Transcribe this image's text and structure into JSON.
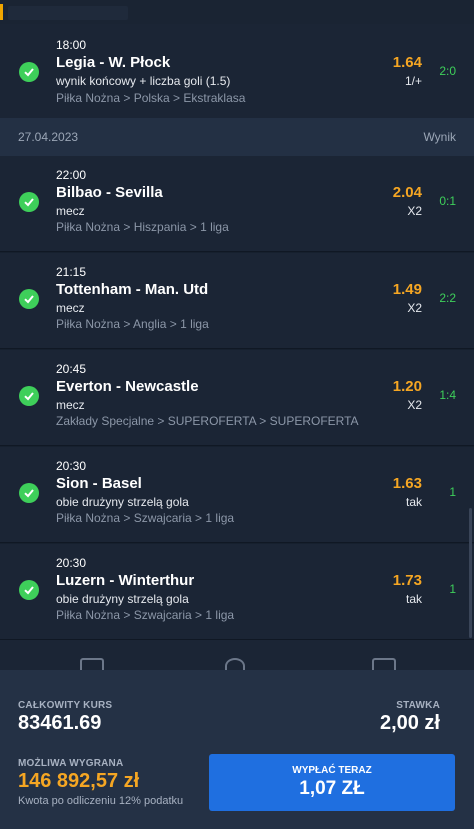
{
  "bets": [
    {
      "time": "18:00",
      "teams": "Legia - W. Płock",
      "market": "wynik końcowy + liczba goli (1.5)",
      "path": "Piłka Nożna > Polska > Ekstraklasa",
      "odds": "1.64",
      "pick": "1/+",
      "result": "2:0",
      "status_icon": "check-icon"
    },
    {
      "time": "22:00",
      "teams": "Bilbao - Sevilla",
      "market": "mecz",
      "path": "Piłka Nożna > Hiszpania > 1 liga",
      "odds": "2.04",
      "pick": "X2",
      "result": "0:1",
      "status_icon": "check-icon"
    },
    {
      "time": "21:15",
      "teams": "Tottenham - Man. Utd",
      "market": "mecz",
      "path": "Piłka Nożna > Anglia > 1 liga",
      "odds": "1.49",
      "pick": "X2",
      "result": "2:2",
      "status_icon": "check-icon"
    },
    {
      "time": "20:45",
      "teams": "Everton - Newcastle",
      "market": "mecz",
      "path": "Zakłady Specjalne > SUPEROFERTA > SUPEROFERTA",
      "odds": "1.20",
      "pick": "X2",
      "result": "1:4",
      "status_icon": "check-icon"
    },
    {
      "time": "20:30",
      "teams": "Sion - Basel",
      "market": "obie drużyny strzelą gola",
      "path": "Piłka Nożna > Szwajcaria > 1 liga",
      "odds": "1.63",
      "pick": "tak",
      "result": "1",
      "status_icon": "check-icon"
    },
    {
      "time": "20:30",
      "teams": "Luzern - Winterthur",
      "market": "obie drużyny strzelą gola",
      "path": "Piłka Nożna > Szwajcaria > 1 liga",
      "odds": "1.73",
      "pick": "tak",
      "result": "1",
      "status_icon": "check-icon"
    }
  ],
  "date_header": {
    "date": "27.04.2023",
    "result_label": "Wynik"
  },
  "summary": {
    "total_odds_label": "CAŁKOWITY KURS",
    "total_odds": "83461.69",
    "stake_label": "STAWKA",
    "stake": "2,00 zł",
    "possible_win_label": "MOŻLIWA WYGRANA",
    "possible_win": "146 892,57 zł",
    "tax_note": "Kwota po odliczeniu 12% podatku",
    "cashout_label": "WYPŁAĆ TERAZ",
    "cashout_value": "1,07 ZŁ"
  },
  "colors": {
    "accent": "#f5a623",
    "win": "#3ecf5a",
    "button": "#1f6fe0",
    "background": "#16202e"
  }
}
